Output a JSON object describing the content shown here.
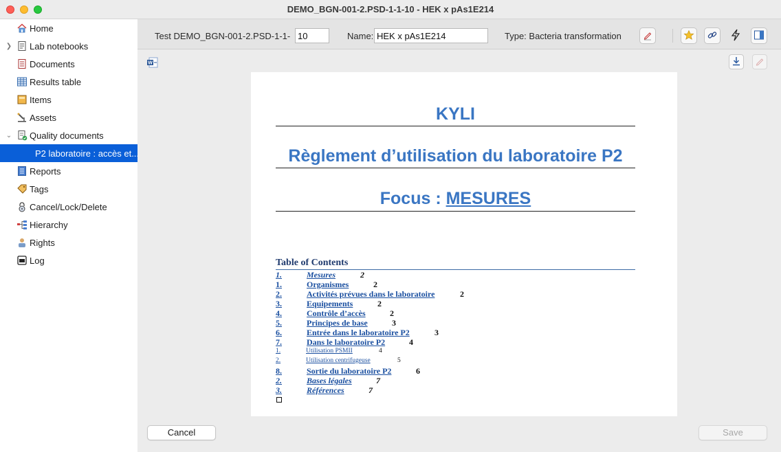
{
  "window": {
    "title": "DEMO_BGN-001-2.PSD-1-1-10 - HEK x pAs1E214"
  },
  "sidebar": {
    "items": [
      {
        "label": "Home",
        "icon": "home-icon"
      },
      {
        "label": "Lab notebooks",
        "icon": "notebook-icon",
        "expandable": true
      },
      {
        "label": "Documents",
        "icon": "document-icon"
      },
      {
        "label": "Results table",
        "icon": "table-icon"
      },
      {
        "label": "Items",
        "icon": "box-icon"
      },
      {
        "label": "Assets",
        "icon": "microscope-icon"
      },
      {
        "label": "Quality documents",
        "icon": "quality-document-icon",
        "expanded": true
      },
      {
        "label": "P2 laboratoire : accès et...",
        "selected": true
      },
      {
        "label": "Reports",
        "icon": "report-icon"
      },
      {
        "label": "Tags",
        "icon": "tag-icon"
      },
      {
        "label": "Cancel/Lock/Delete",
        "icon": "lock-icon"
      },
      {
        "label": "Hierarchy",
        "icon": "hierarchy-icon"
      },
      {
        "label": "Rights",
        "icon": "rights-icon"
      },
      {
        "label": "Log",
        "icon": "log-icon"
      }
    ]
  },
  "toolbar": {
    "test_label": "Test DEMO_BGN-001-2.PSD-1-1-",
    "test_value": "10",
    "name_label": "Name:",
    "name_value": "HEK x pAs1E214",
    "type_text": "Type: Bacteria transformation",
    "icons": [
      "edit-pencil-icon",
      "star-icon",
      "link-icon",
      "lightning-icon",
      "panel-icon"
    ]
  },
  "document_actions": [
    "word-export-icon",
    "download-icon",
    "edit-icon"
  ],
  "document": {
    "heading1": "KYLI",
    "heading2": "Règlement d’utilisation du laboratoire P2",
    "heading3_prefix": "Focus : ",
    "heading3_link": "MESURES",
    "toc_title": "Table of Contents",
    "toc": [
      {
        "num": "1.",
        "text": "Mesures",
        "page": "2",
        "style": "italic"
      },
      {
        "num": "1.",
        "text": "Organismes",
        "page": "2",
        "style": "bold"
      },
      {
        "num": "2.",
        "text": "Activités prévues dans le laboratoire",
        "page": "2",
        "style": "bold"
      },
      {
        "num": "3.",
        "text": "Equipements",
        "page": "2",
        "style": "bold"
      },
      {
        "num": "4.",
        "text": "Contrôle d’accès",
        "page": "2",
        "style": "bold"
      },
      {
        "num": "5.",
        "text": "Principes de base",
        "page": "3",
        "style": "bold"
      },
      {
        "num": "6.",
        "text": "Entrée dans le laboratoire P2",
        "page": "3",
        "style": "bold"
      },
      {
        "num": "7.",
        "text": "Dans le laboratoire P2",
        "page": "4",
        "style": "bold"
      },
      {
        "num": "1.",
        "text": "Utilisation PSMII",
        "page": "4",
        "style": "small"
      },
      {
        "num": "2.",
        "text": "Utilisation centrifugeuse",
        "page": "5",
        "style": "small"
      },
      {
        "num": "8.",
        "text": "Sortie du laboratoire P2",
        "page": "6",
        "style": "bold"
      },
      {
        "num": "2.",
        "text": "Bases légales",
        "page": "7",
        "style": "italic"
      },
      {
        "num": "3.",
        "text": "Références",
        "page": "7",
        "style": "italic"
      }
    ]
  },
  "footer": {
    "cancel_label": "Cancel",
    "save_label": "Save"
  },
  "colors": {
    "accent": "#0a5fd8",
    "heading": "#3a76c3",
    "link": "#1a4fa0"
  }
}
